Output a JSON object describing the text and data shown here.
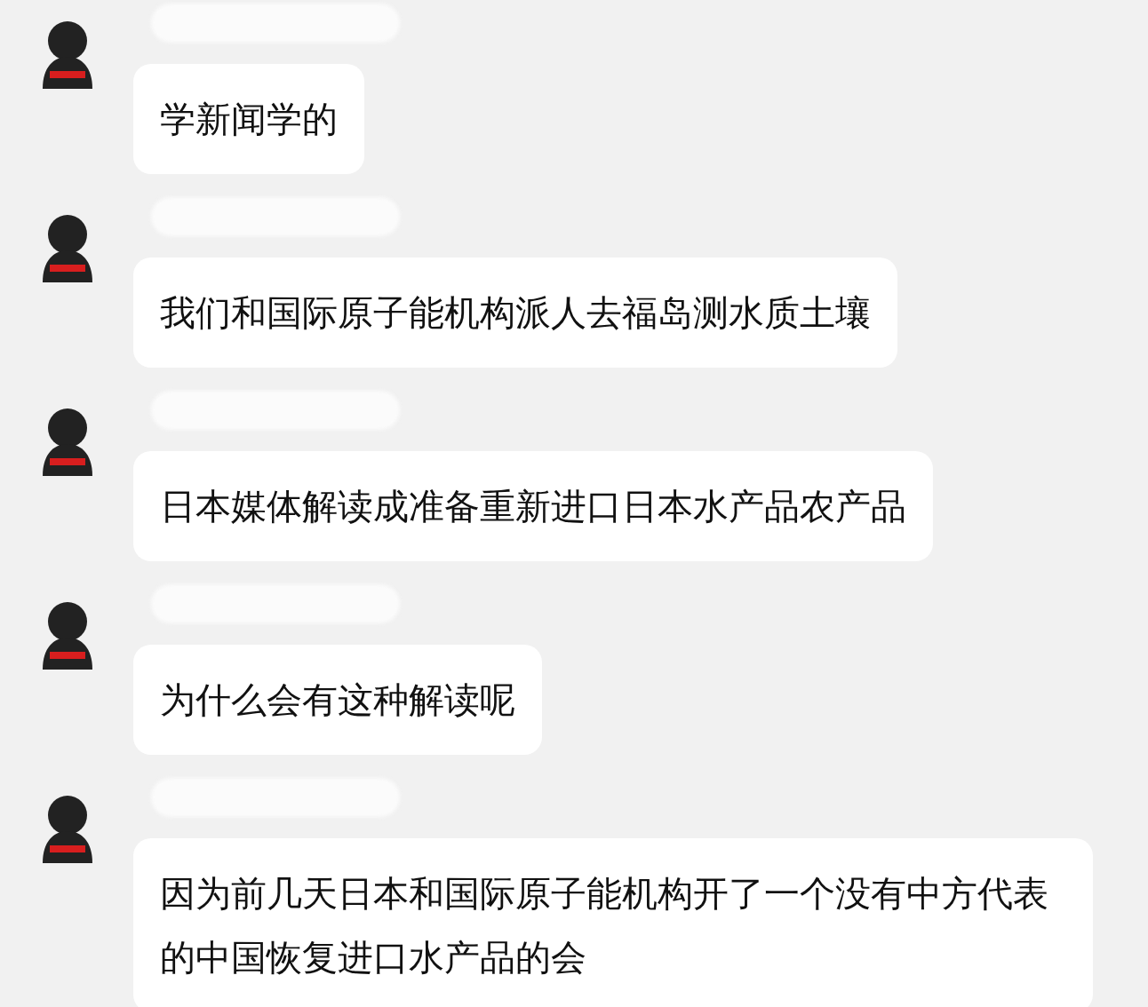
{
  "messages": [
    {
      "text": "学新闻学的"
    },
    {
      "text": "我们和国际原子能机构派人去福岛测水质土壤"
    },
    {
      "text": "日本媒体解读成准备重新进口日本水产品农产品"
    },
    {
      "text": "为什么会有这种解读呢"
    },
    {
      "text": "因为前几天日本和国际原子能机构开了一个没有中方代表的中国恢复进口水产品的会"
    }
  ]
}
